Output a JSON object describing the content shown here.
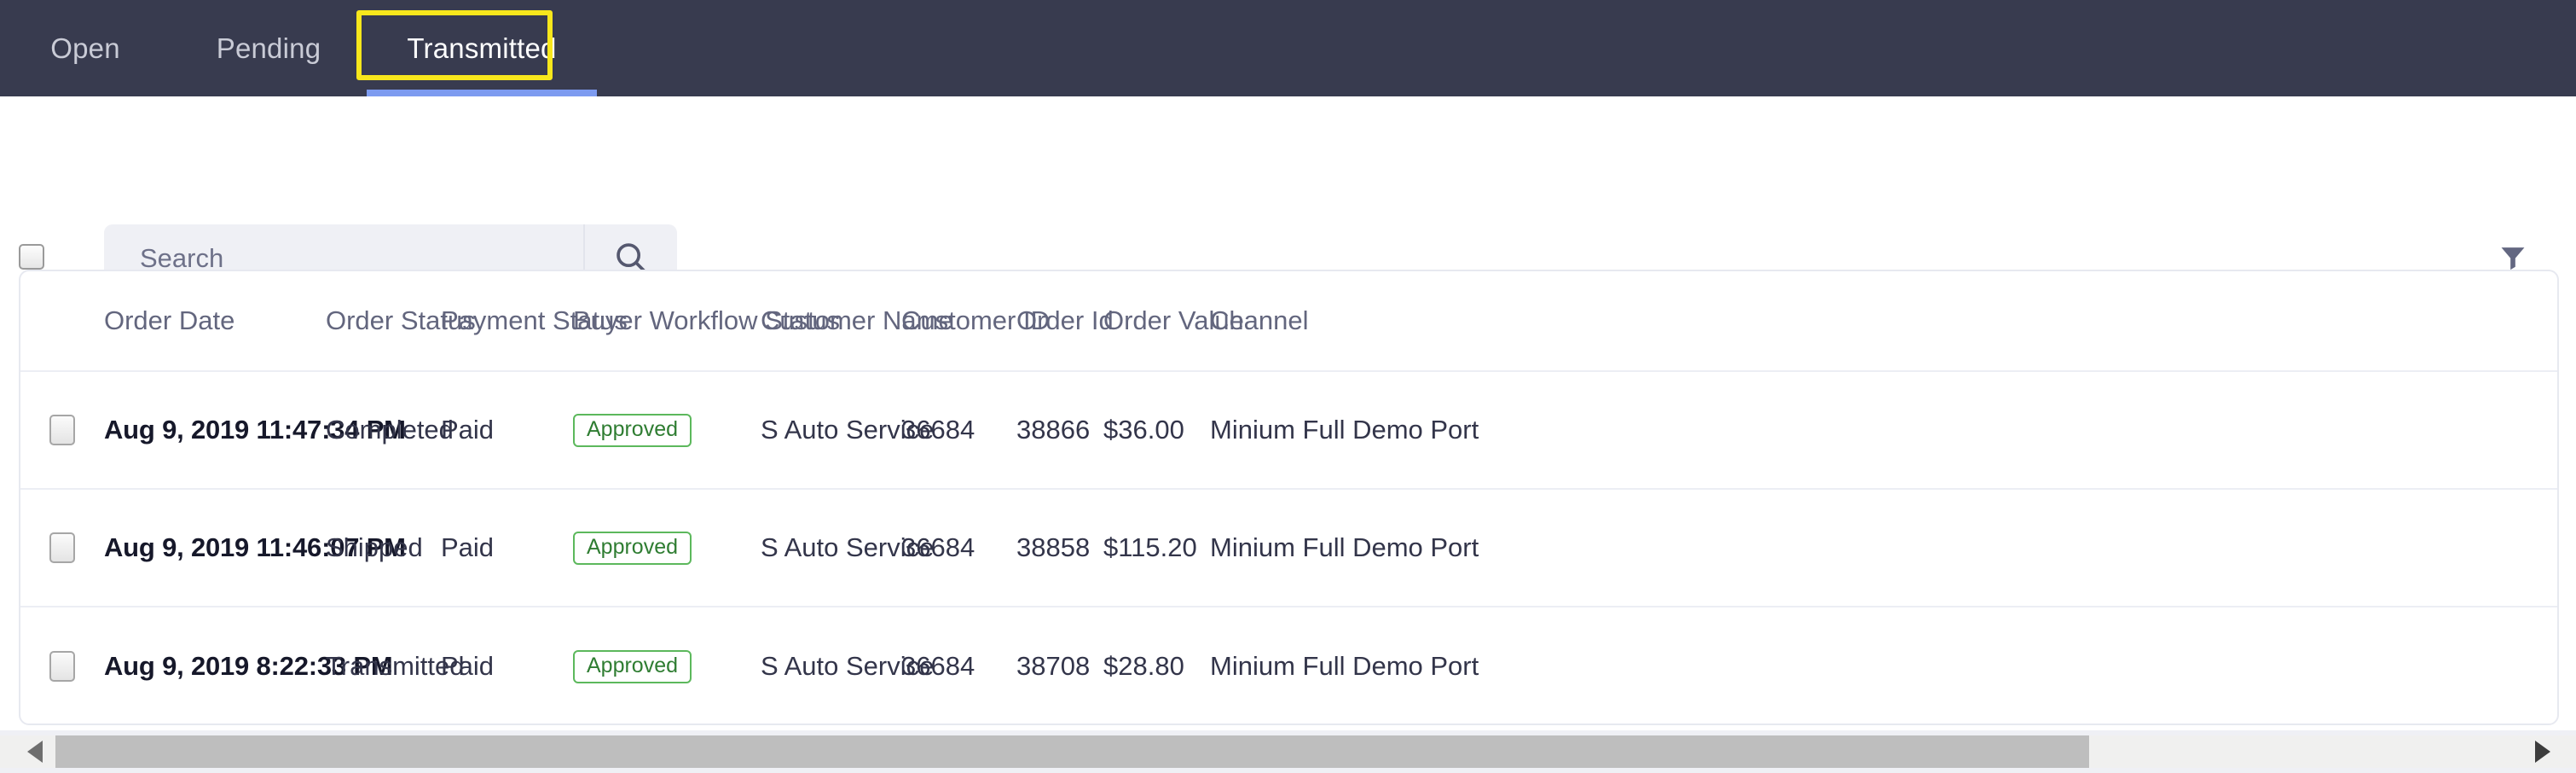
{
  "tabs": [
    {
      "label": "Open",
      "active": false
    },
    {
      "label": "Pending",
      "active": false
    },
    {
      "label": "Transmitted",
      "active": true
    }
  ],
  "toolbar": {
    "search_placeholder": "Search",
    "search_value": "",
    "search_icon": "search-icon",
    "filter_icon": "filter-funnel-icon",
    "select_all_checked": false
  },
  "colors": {
    "header_bg": "#383b4f",
    "tab_active_underline": "#7d9bf0",
    "highlight_outline": "#f8e71c",
    "badge_border": "#5cb85c",
    "badge_text": "#2f7d32",
    "card_border": "#e7e9f0",
    "search_bg": "#eff0f5"
  },
  "table": {
    "headers": [
      "Order Date",
      "Order Status",
      "Payment Status",
      "Buyer Workflow Status",
      "Customer Name",
      "Customer ID",
      "Order Id",
      "Order Value",
      "Channel"
    ],
    "rows": [
      {
        "order_date": "Aug 9, 2019 11:47:34 PM",
        "order_status": "Completed",
        "payment_status": "Paid",
        "buyer_workflow_status": "Approved",
        "customer_name": "S Auto Service",
        "customer_id": "36684",
        "order_id": "38866",
        "order_value": "$36.00",
        "channel": "Minium Full Demo Port"
      },
      {
        "order_date": "Aug 9, 2019 11:46:07 PM",
        "order_status": "Shipped",
        "payment_status": "Paid",
        "buyer_workflow_status": "Approved",
        "customer_name": "S Auto Service",
        "customer_id": "36684",
        "order_id": "38858",
        "order_value": "$115.20",
        "channel": "Minium Full Demo Port"
      },
      {
        "order_date": "Aug 9, 2019 8:22:33 PM",
        "order_status": "Transmitted",
        "payment_status": "Paid",
        "buyer_workflow_status": "Approved",
        "customer_name": "S Auto Service",
        "customer_id": "36684",
        "order_id": "38708",
        "order_value": "$28.80",
        "channel": "Minium Full Demo Port"
      }
    ]
  },
  "scrollbar": {
    "left_arrow_icon": "caret-left-icon",
    "right_arrow_icon": "caret-right-icon"
  }
}
